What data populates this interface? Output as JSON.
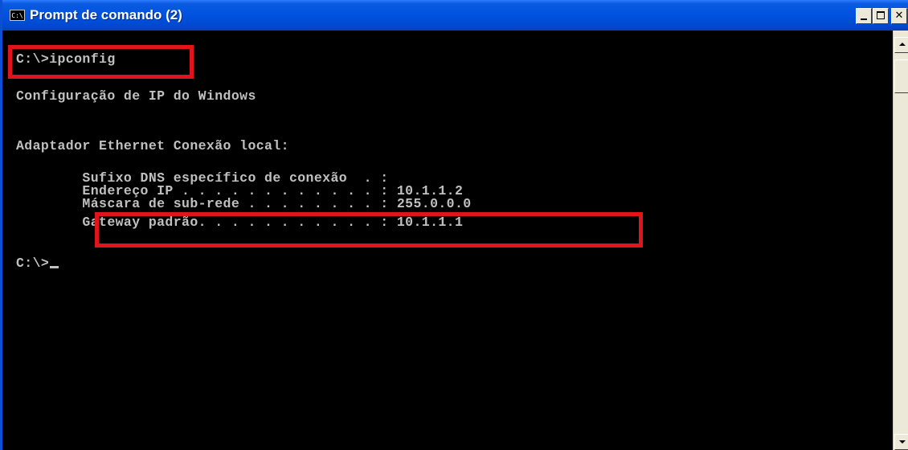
{
  "window": {
    "title": "Prompt de comando (2)",
    "icon_label": "C:\\",
    "buttons": {
      "minimize": "minimize",
      "maximize": "maximize",
      "close": "✕"
    }
  },
  "console": {
    "lines": [
      "C:\\>ipconfig",
      "Configuração de IP do Windows",
      "Adaptador Ethernet Conexão local:",
      "        Sufixo DNS específico de conexão  . :",
      "        Endereço IP . . . . . . . . . . . . : 10.1.1.2",
      "        Máscara de sub-rede . . . . . . . . : 255.0.0.0",
      "        Gateway padrão. . . . . . . . . . . : 10.1.1.1",
      "C:\\>"
    ]
  },
  "colors": {
    "console_background": "#000000",
    "console_text": "#c0c0c0",
    "highlight_border": "#e0141c",
    "titlebar": "#0052e0"
  }
}
